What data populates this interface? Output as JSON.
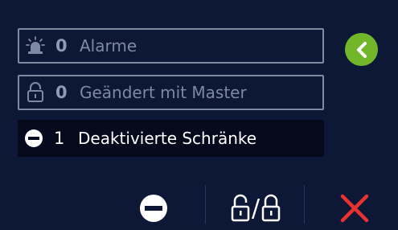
{
  "status_list": {
    "alarms": {
      "count": "0",
      "label": "Alarme"
    },
    "changed_with_master": {
      "count": "0",
      "label": "Geändert mit Master"
    },
    "deactivated_lockers": {
      "count": "1",
      "label": "Deaktivierte Schränke"
    }
  },
  "icons": {
    "alarm": "alarm-siren-icon",
    "lock": "lock-icon",
    "deactivate": "minus-circle-icon",
    "back": "chevron-left-icon",
    "lock_unlock": "unlock-lock-icon",
    "close": "close-x-icon"
  },
  "toolbar": {
    "separator_glyph": "/"
  },
  "colors": {
    "background": "#0c1835",
    "accent_green": "#72b62a",
    "close_red": "#e8322f",
    "dim_text": "#7c8aa6"
  }
}
